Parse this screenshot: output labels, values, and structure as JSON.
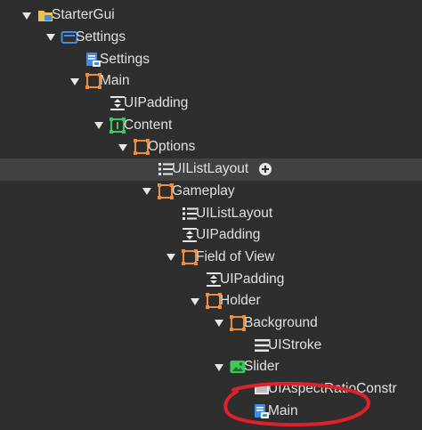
{
  "tree": [
    {
      "label": "StarterGui",
      "depth": 0,
      "expanded": true,
      "icon": "startergui-icon"
    },
    {
      "label": "Settings",
      "depth": 1,
      "expanded": true,
      "icon": "screengui-icon"
    },
    {
      "label": "Settings",
      "depth": 2,
      "expanded": null,
      "icon": "localscript-icon"
    },
    {
      "label": "Main",
      "depth": 2,
      "expanded": true,
      "icon": "frame-icon"
    },
    {
      "label": "UIPadding",
      "depth": 3,
      "expanded": null,
      "icon": "uipadding-icon"
    },
    {
      "label": "Content",
      "depth": 3,
      "expanded": true,
      "icon": "scrollingframe-icon"
    },
    {
      "label": "Options",
      "depth": 4,
      "expanded": true,
      "icon": "frame-icon"
    },
    {
      "label": "UIListLayout",
      "depth": 5,
      "expanded": null,
      "icon": "uilistlayout-icon",
      "selected": true,
      "add_button": true
    },
    {
      "label": "Gameplay",
      "depth": 5,
      "expanded": true,
      "icon": "frame-icon"
    },
    {
      "label": "UIListLayout",
      "depth": 6,
      "expanded": null,
      "icon": "uilistlayout-icon"
    },
    {
      "label": "UIPadding",
      "depth": 6,
      "expanded": null,
      "icon": "uipadding-icon"
    },
    {
      "label": "Field of View",
      "depth": 6,
      "expanded": true,
      "icon": "frame-icon"
    },
    {
      "label": "UIPadding",
      "depth": 7,
      "expanded": null,
      "icon": "uipadding-icon"
    },
    {
      "label": "Holder",
      "depth": 7,
      "expanded": true,
      "icon": "frame-icon"
    },
    {
      "label": "Background",
      "depth": 8,
      "expanded": true,
      "icon": "frame-icon"
    },
    {
      "label": "UIStroke",
      "depth": 9,
      "expanded": null,
      "icon": "uistroke-icon"
    },
    {
      "label": "Slider",
      "depth": 8,
      "expanded": true,
      "icon": "imagebutton-icon"
    },
    {
      "label": "UIAspectRatioConstr",
      "depth": 9,
      "expanded": null,
      "icon": "uiaspectratio-icon"
    },
    {
      "label": "Main",
      "depth": 9,
      "expanded": null,
      "icon": "localscript-icon"
    }
  ],
  "colors": {
    "background": "#2e2e2e",
    "selected_row": "#424242",
    "text": "#e0e0e0",
    "frame_orange": "#f08c3a",
    "green": "#3cc85a",
    "blue": "#3a8ee6",
    "annotation_red": "#e0202a"
  }
}
